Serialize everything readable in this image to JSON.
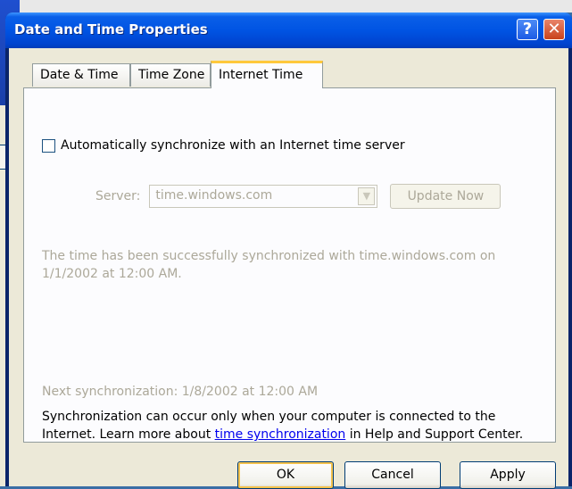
{
  "window": {
    "title": "Date and Time Properties",
    "help_label": "?",
    "close_label": "✕"
  },
  "tabs": [
    {
      "label": "Date & Time"
    },
    {
      "label": "Time Zone"
    },
    {
      "label": "Internet Time",
      "active": true
    }
  ],
  "internet_time": {
    "auto_sync_label": "Automatically synchronize with an Internet time server",
    "auto_sync_checked": false,
    "server_label": "Server:",
    "server_value": "time.windows.com",
    "update_now_label": "Update Now",
    "status_message": "The time has been successfully synchronized with time.windows.com on 1/1/2002 at 12:00 AM.",
    "next_sync": "Next synchronization: 1/8/2002 at 12:00 AM",
    "info_prefix": "Synchronization can occur only when your computer is connected to the Internet.  Learn more about ",
    "info_link": "time synchronization",
    "info_suffix": " in Help and Support Center."
  },
  "buttons": {
    "ok": "OK",
    "cancel": "Cancel",
    "apply": "Apply"
  },
  "colors": {
    "titlebar": "#0054e3",
    "face": "#ece9d8",
    "disabled_text": "#aca899",
    "link": "#0000ee",
    "tab_highlight": "#ffc83c"
  }
}
